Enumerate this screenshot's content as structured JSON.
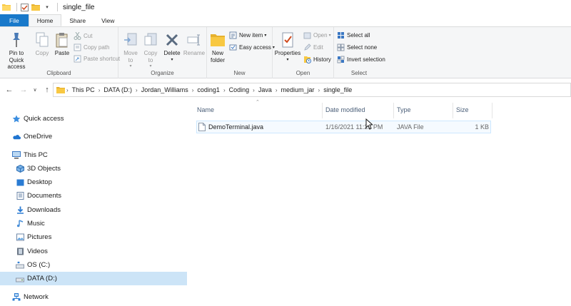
{
  "window": {
    "title": "single_file"
  },
  "tabs": [
    {
      "label": "File"
    },
    {
      "label": "Home"
    },
    {
      "label": "Share"
    },
    {
      "label": "View"
    }
  ],
  "ribbon": {
    "clipboard": {
      "label": "Clipboard",
      "pin": "Pin to Quick access",
      "copy": "Copy",
      "paste": "Paste",
      "cut": "Cut",
      "copy_path": "Copy path",
      "paste_shortcut": "Paste shortcut"
    },
    "organize": {
      "label": "Organize",
      "move_to": "Move to",
      "copy_to": "Copy to",
      "delete": "Delete",
      "rename": "Rename"
    },
    "new": {
      "label": "New",
      "new_folder": "New folder",
      "new_item": "New item",
      "easy_access": "Easy access"
    },
    "open": {
      "label": "Open",
      "properties": "Properties",
      "open": "Open",
      "edit": "Edit",
      "history": "History"
    },
    "select": {
      "label": "Select",
      "select_all": "Select all",
      "select_none": "Select none",
      "invert_selection": "Invert selection"
    }
  },
  "breadcrumb": [
    "This PC",
    "DATA (D:)",
    "Jordan_Williams",
    "coding1",
    "Coding",
    "Java",
    "medium_jar",
    "single_file"
  ],
  "navpane": [
    {
      "label": "Quick access",
      "icon": "star-icon"
    },
    {
      "label": "OneDrive",
      "icon": "cloud-icon"
    },
    {
      "label": "This PC",
      "icon": "computer-icon"
    },
    {
      "label": "3D Objects",
      "icon": "cube-icon"
    },
    {
      "label": "Desktop",
      "icon": "desktop-icon"
    },
    {
      "label": "Documents",
      "icon": "documents-icon"
    },
    {
      "label": "Downloads",
      "icon": "download-icon"
    },
    {
      "label": "Music",
      "icon": "music-icon"
    },
    {
      "label": "Pictures",
      "icon": "pictures-icon"
    },
    {
      "label": "Videos",
      "icon": "videos-icon"
    },
    {
      "label": "OS (C:)",
      "icon": "drive-icon"
    },
    {
      "label": "DATA (D:)",
      "icon": "drive-icon"
    },
    {
      "label": "Network",
      "icon": "network-icon"
    }
  ],
  "columns": {
    "name": "Name",
    "date": "Date modified",
    "type": "Type",
    "size": "Size"
  },
  "files": [
    {
      "name": "DemoTerminal.java",
      "date": "1/16/2021 11:25 PM",
      "type": "JAVA File",
      "size": "1 KB"
    }
  ],
  "colors": {
    "file_tab": "#1979ca",
    "selection": "#cce4f7",
    "hover_row": "#f5faff",
    "folder": "#f8c842"
  }
}
